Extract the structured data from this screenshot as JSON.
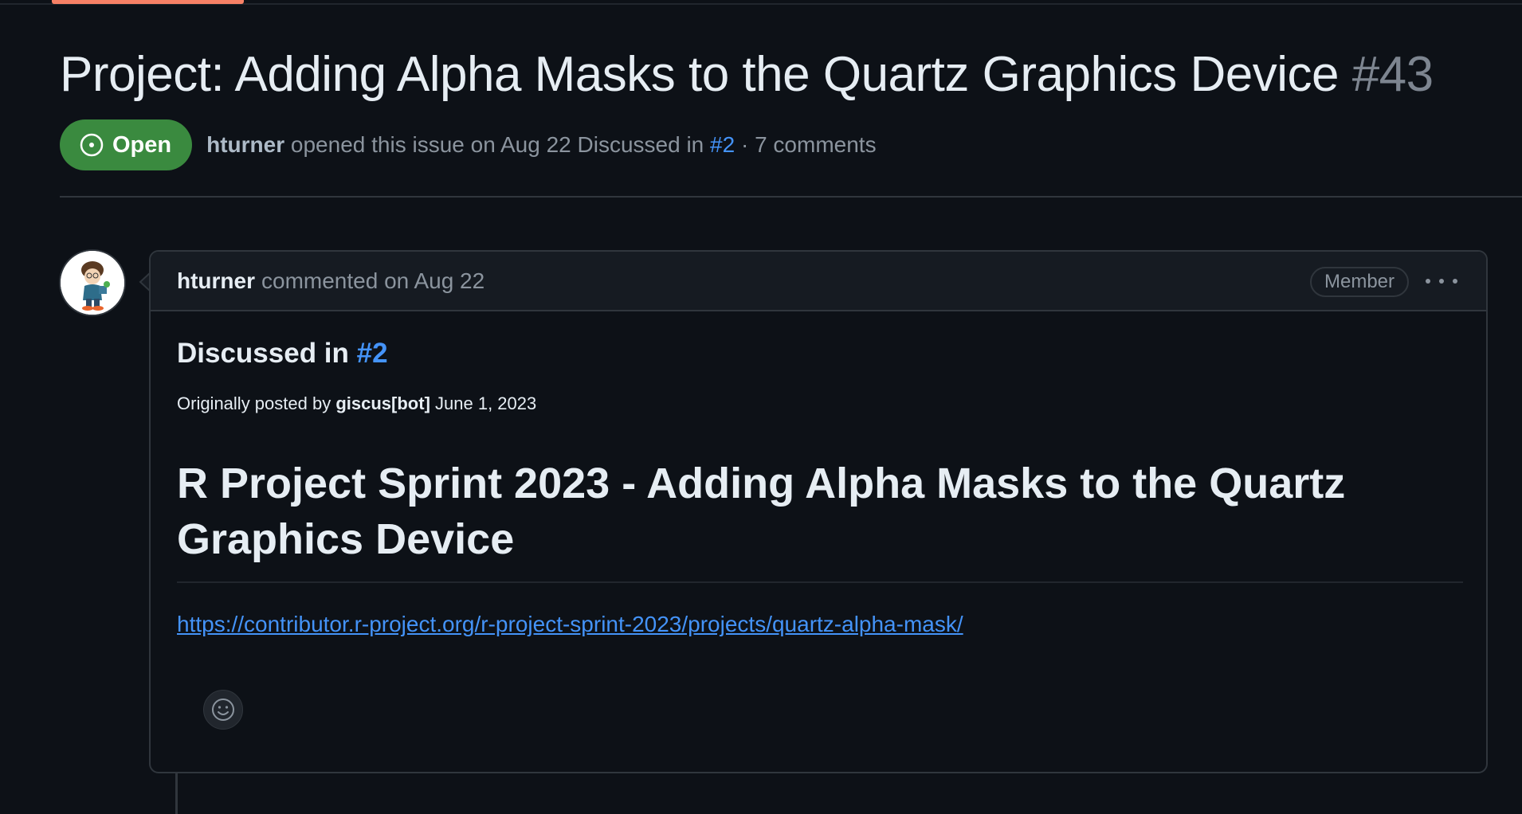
{
  "issue": {
    "title": "Project: Adding Alpha Masks to the Quartz Graphics Device",
    "number": "#43",
    "state": "Open",
    "meta": {
      "author": "hturner",
      "opened_text": "opened this issue on Aug 22 Discussed in",
      "discussion_link": "#2",
      "comments_text": "· 7 comments"
    }
  },
  "comment": {
    "author": "hturner",
    "action": "commented on Aug 22",
    "role_badge": "Member",
    "body": {
      "discussed_prefix": "Discussed in",
      "discussed_link": "#2",
      "orig_prefix": "Originally posted by",
      "orig_author": "giscus[bot]",
      "orig_date": "June 1, 2023",
      "heading": "R Project Sprint 2023 - Adding Alpha Masks to the Quartz Graphics Device",
      "link": "https://contributor.r-project.org/r-project-sprint-2023/projects/quartz-alpha-mask/"
    }
  },
  "colors": {
    "background": "#0d1117",
    "open_badge": "#3a8a3f",
    "link": "#4493f8",
    "tab_accent": "#f78166"
  },
  "icons": [
    "issue-opened-icon",
    "kebab-icon",
    "smiley-icon"
  ]
}
